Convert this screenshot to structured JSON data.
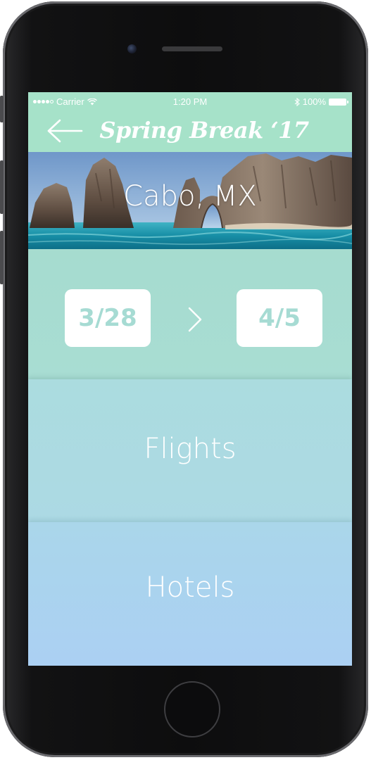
{
  "status_bar": {
    "carrier": "Carrier",
    "time": "1:20 PM",
    "battery": "100%"
  },
  "nav": {
    "title": "Spring Break ‘17",
    "back_icon": "left-arrow-icon"
  },
  "hero": {
    "title": "Cabo, MX"
  },
  "dates": {
    "start": "3/28",
    "end": "4/5",
    "separator_icon": "chevron-right-icon"
  },
  "sections": {
    "flights_label": "Flights",
    "hotels_label": "Hotels"
  },
  "colors": {
    "header": "#a6e2c9",
    "date_text": "#a6dbd3",
    "flights_bg": "#acdae2",
    "hotels_bg": "#abd2f0"
  }
}
